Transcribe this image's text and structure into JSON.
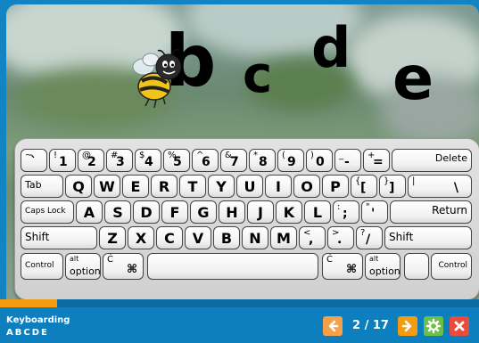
{
  "scene": {
    "letters": [
      "b",
      "c",
      "d",
      "e"
    ]
  },
  "keyboard": {
    "row1": [
      {
        "top": "~",
        "bot": "`"
      },
      {
        "top": "!",
        "bot": "1"
      },
      {
        "top": "@",
        "bot": "2"
      },
      {
        "top": "#",
        "bot": "3"
      },
      {
        "top": "$",
        "bot": "4"
      },
      {
        "top": "%",
        "bot": "5"
      },
      {
        "top": "^",
        "bot": "6"
      },
      {
        "top": "&",
        "bot": "7"
      },
      {
        "top": "*",
        "bot": "8"
      },
      {
        "top": "(",
        "bot": "9"
      },
      {
        "top": ")",
        "bot": "0"
      },
      {
        "top": "_",
        "bot": "-"
      },
      {
        "top": "+",
        "bot": "="
      }
    ],
    "delete": "Delete",
    "tab": "Tab",
    "row2": [
      "Q",
      "W",
      "E",
      "R",
      "T",
      "Y",
      "U",
      "I",
      "O",
      "P"
    ],
    "row2_sym": [
      {
        "top": "{",
        "bot": "["
      },
      {
        "top": "}",
        "bot": "]"
      },
      {
        "top": "|",
        "bot": "\\"
      }
    ],
    "caps": "Caps Lock",
    "row3": [
      "A",
      "S",
      "D",
      "F",
      "G",
      "H",
      "J",
      "K",
      "L"
    ],
    "row3_sym": [
      {
        "top": ":",
        "bot": ";"
      },
      {
        "top": "\"",
        "bot": "'"
      }
    ],
    "return": "Return",
    "shift_left": "Shift",
    "row4": [
      "Z",
      "X",
      "C",
      "V",
      "B",
      "N",
      "M"
    ],
    "row4_sym": [
      {
        "top": "<",
        "bot": ","
      },
      {
        "top": ">",
        "bot": "."
      },
      {
        "top": "?",
        "bot": "/"
      }
    ],
    "shift_right": "Shift",
    "control_left": "Control",
    "option_left": {
      "top": "alt",
      "bot": "option"
    },
    "cmd_left": {
      "sym": "⌘",
      "apple": "Ć"
    },
    "cmd_right": {
      "sym": "⌘",
      "apple": "Ć"
    },
    "option_right": {
      "top": "alt",
      "bot": "option"
    },
    "control_right": "Control"
  },
  "footer": {
    "title": "Keyboarding",
    "subtitle": "ABCDE",
    "counter": "2 / 17",
    "progress": 0.12
  },
  "colors": {
    "prev_button": "#f5a04a",
    "next_button": "#f39c12",
    "settings_button": "#6cc04a",
    "close_button": "#e84c3d"
  }
}
